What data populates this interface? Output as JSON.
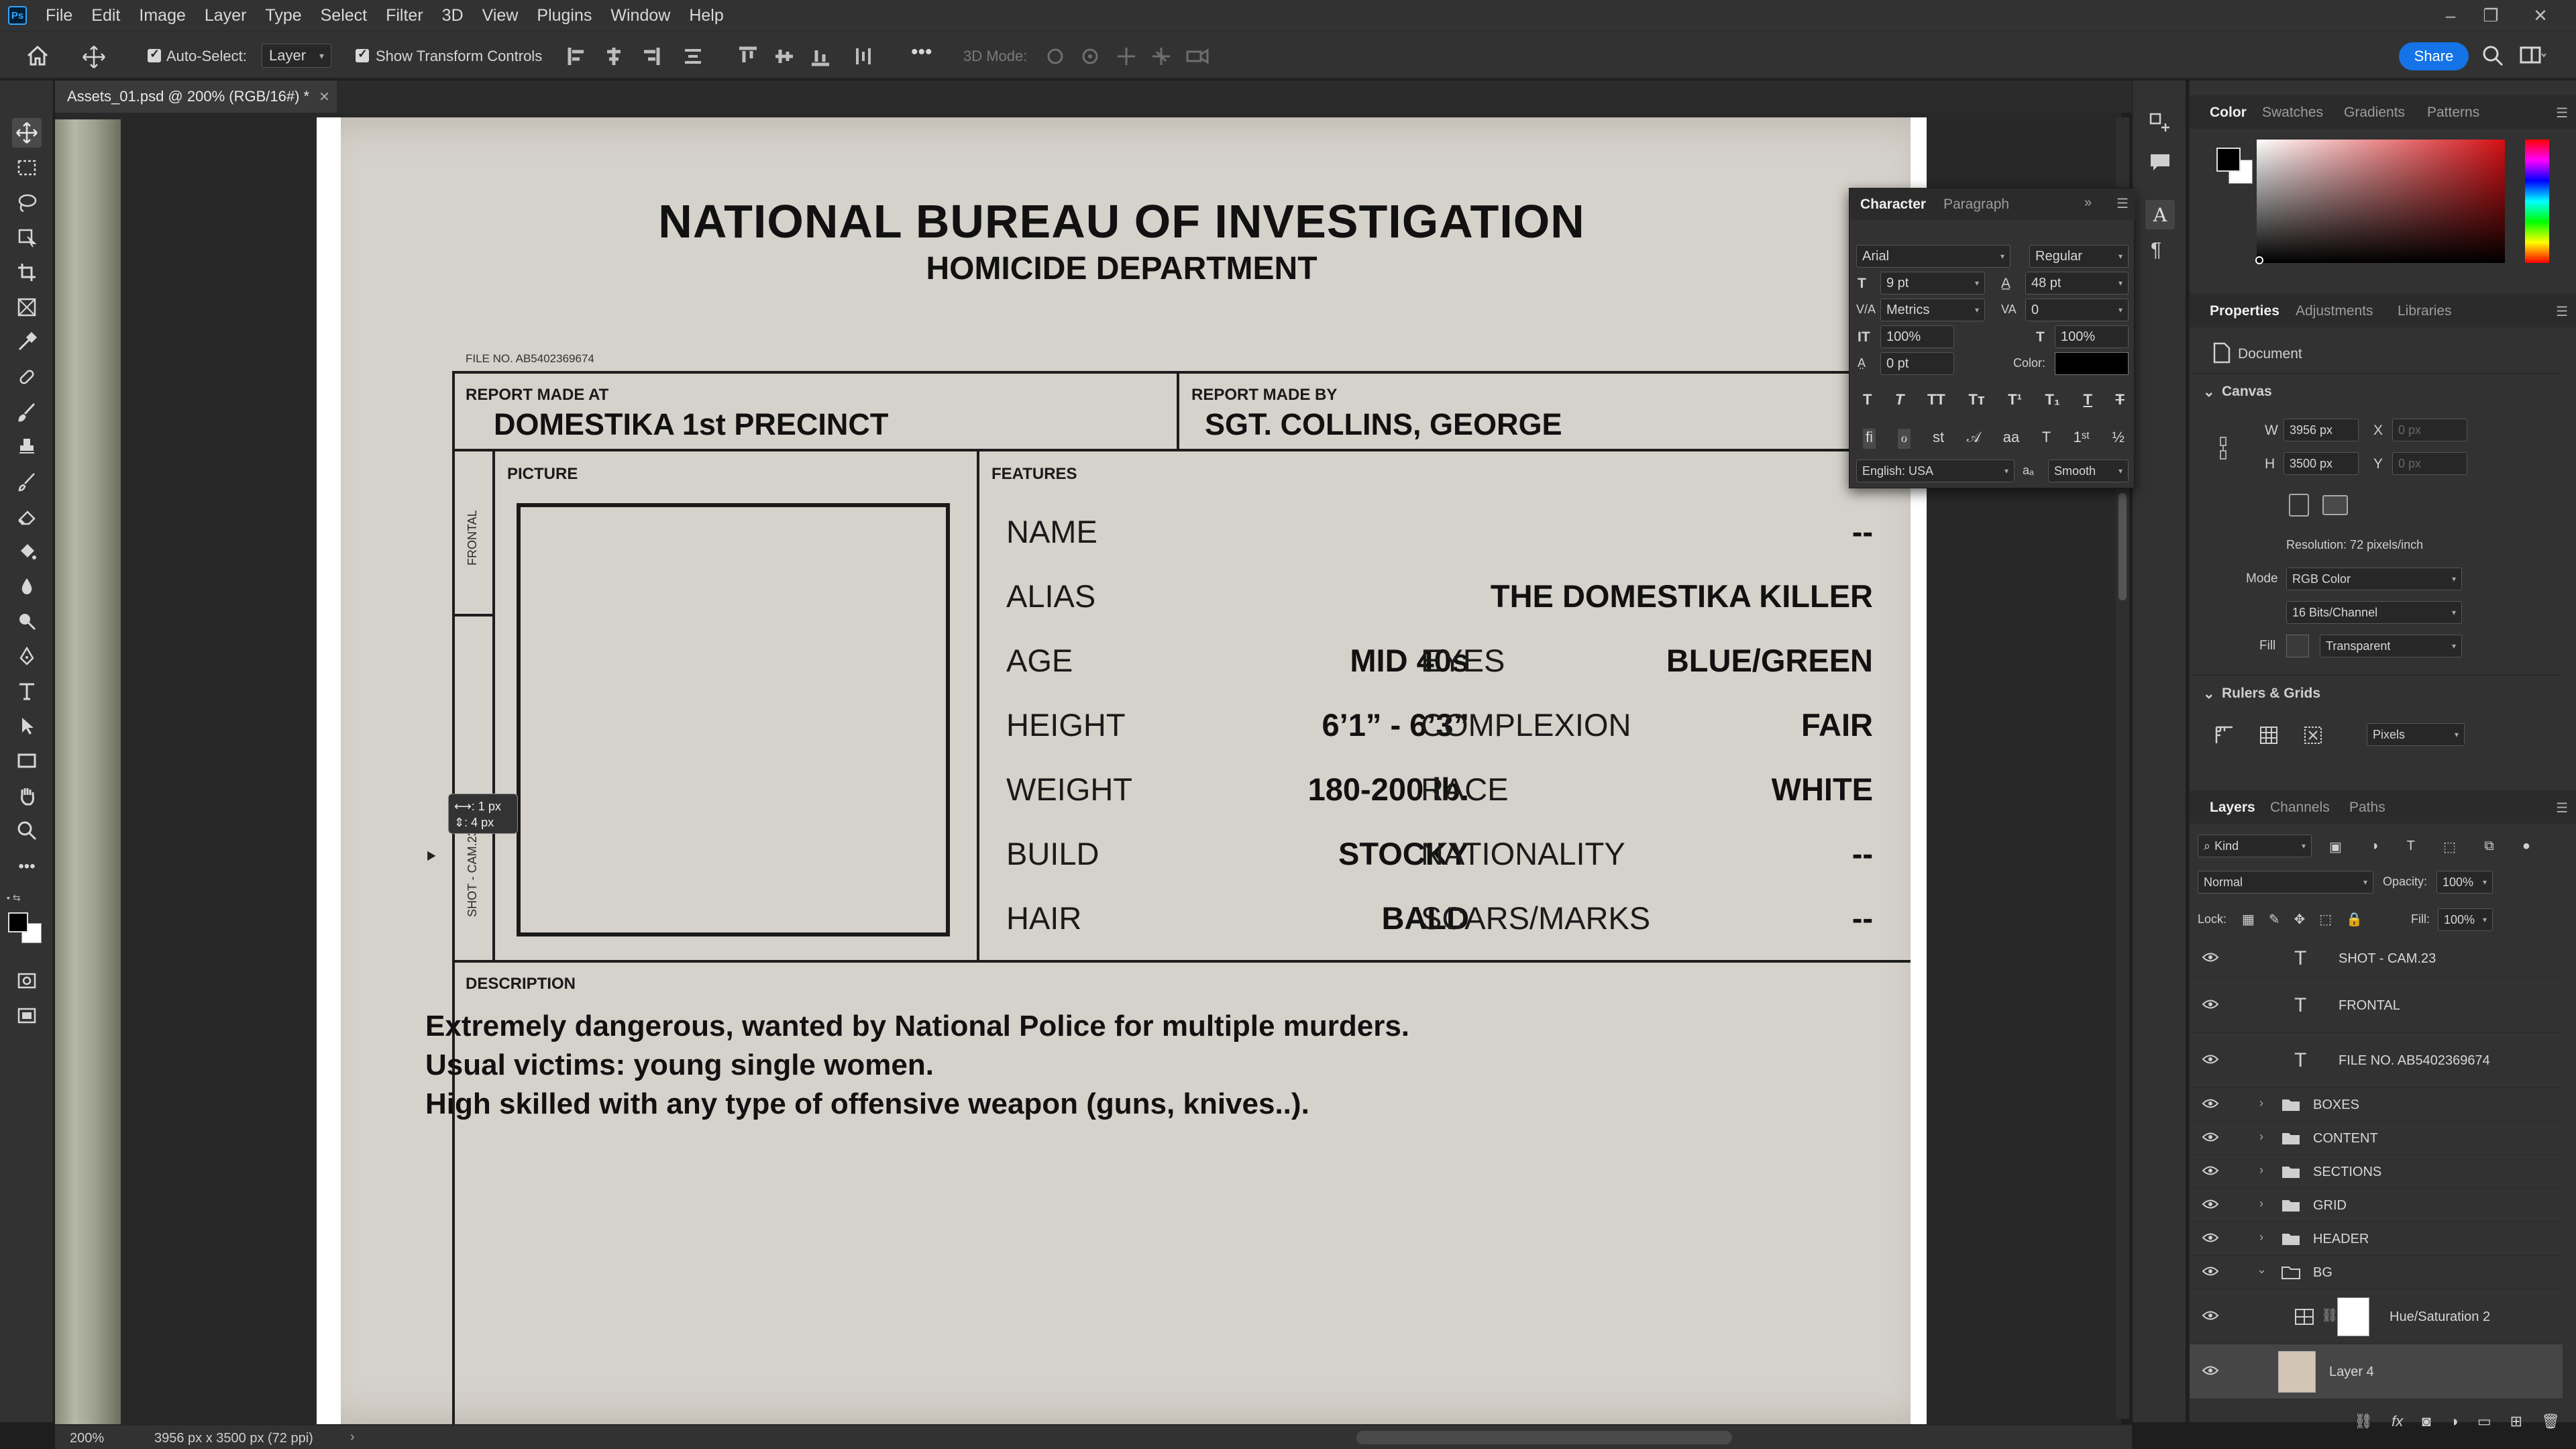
{
  "menubar": {
    "items": [
      "File",
      "Edit",
      "Image",
      "Layer",
      "Type",
      "Select",
      "Filter",
      "3D",
      "View",
      "Plugins",
      "Window",
      "Help"
    ]
  },
  "options": {
    "auto_select_label": "Auto-Select:",
    "auto_select_value": "Layer",
    "transform_controls_label": "Show Transform Controls",
    "mode_3d_label": "3D Mode:",
    "share_label": "Share"
  },
  "document": {
    "tab_title": "Assets_01.psd @ 200% (RGB/16#) *",
    "title": "NATIONAL BUREAU OF INVESTIGATION",
    "subtitle": "HOMICIDE DEPARTMENT",
    "file_no": "FILE NO. AB5402369674",
    "report_made_at_label": "REPORT MADE AT",
    "report_made_at_value": "DOMESTIKA 1st PRECINCT",
    "report_made_by_label": "REPORT MADE BY",
    "report_made_by_value": "SGT. COLLINS, GEORGE",
    "picture_label": "PICTURE",
    "frontal_label": "FRONTAL",
    "shot_label": "SHOT - CAM.23",
    "features_label": "FEATURES",
    "features": {
      "name_label": "NAME",
      "name_value": "--",
      "alias_label": "ALIAS",
      "alias_value": "THE DOMESTIKA KILLER",
      "age_label": "AGE",
      "age_value": "MID 40s",
      "eyes_label": "EYES",
      "eyes_value": "BLUE/GREEN",
      "height_label": "HEIGHT",
      "height_value": "6’1” - 6’3”",
      "complexion_label": "COMPLEXION",
      "complexion_value": "FAIR",
      "weight_label": "WEIGHT",
      "weight_value": "180-200 lb.",
      "race_label": "RACE",
      "race_value": "WHITE",
      "build_label": "BUILD",
      "build_value": "STOCKY",
      "nationality_label": "NATIONALITY",
      "nationality_value": "--",
      "hair_label": "HAIR",
      "hair_value": "BALD",
      "scars_label": "SCARS/MARKS",
      "scars_value": "--"
    },
    "description_label": "DESCRIPTION",
    "description_lines": [
      "Extremely dangerous, wanted by National Police for multiple murders.",
      "Usual victims: young single women.",
      "High skilled with any type of offensive weapon (guns, knives..)."
    ]
  },
  "tooltip": {
    "line1": "⟷: 1 px",
    "line2": "⇕: 4 px"
  },
  "status": {
    "zoom": "200%",
    "doc_size": "3956 px x 3500 px (72 ppi)"
  },
  "character_panel": {
    "tabs": [
      "Character",
      "Paragraph"
    ],
    "font_family": "Arial",
    "font_style": "Regular",
    "font_size": "9 pt",
    "leading": "48 pt",
    "kerning": "Metrics",
    "tracking": "0",
    "vertical_scale": "100%",
    "horizontal_scale": "100%",
    "baseline_shift": "0 pt",
    "color_label": "Color:",
    "language": "English: USA",
    "antialias": "Smooth",
    "text_color": "#000000"
  },
  "color_panel": {
    "tabs": [
      "Color",
      "Swatches",
      "Gradients",
      "Patterns"
    ],
    "foreground": "#000000",
    "background": "#ffffff",
    "hue_color": "#d41014"
  },
  "properties_panel": {
    "tabs": [
      "Properties",
      "Adjustments",
      "Libraries"
    ],
    "doc_label": "Document",
    "canvas_label": "Canvas",
    "w_label": "W",
    "w_value": "3956 px",
    "h_label": "H",
    "h_value": "3500 px",
    "x_label": "X",
    "x_placeholder": "0 px",
    "y_label": "Y",
    "y_placeholder": "0 px",
    "resolution": "Resolution: 72 pixels/inch",
    "mode_label": "Mode",
    "mode_value": "RGB Color",
    "bits_value": "16 Bits/Channel",
    "fill_label": "Fill",
    "fill_value": "Transparent",
    "rulers_label": "Rulers & Grids",
    "units_value": "Pixels"
  },
  "layers_panel": {
    "tabs": [
      "Layers",
      "Channels",
      "Paths"
    ],
    "filter_kind": "Kind",
    "blend_mode": "Normal",
    "opacity_label": "Opacity:",
    "opacity_value": "100%",
    "lock_label": "Lock:",
    "fill_label": "Fill:",
    "fill_value": "100%",
    "layers": [
      {
        "name": "SHOT - CAM.23",
        "type": "text"
      },
      {
        "name": "FRONTAL",
        "type": "text"
      },
      {
        "name": "FILE NO. AB5402369674",
        "type": "text"
      },
      {
        "name": "BOXES",
        "type": "group"
      },
      {
        "name": "CONTENT",
        "type": "group"
      },
      {
        "name": "SECTIONS",
        "type": "group"
      },
      {
        "name": "GRID",
        "type": "group"
      },
      {
        "name": "HEADER",
        "type": "group"
      },
      {
        "name": "BG",
        "type": "group-open"
      },
      {
        "name": "Hue/Saturation 2",
        "type": "adjustment"
      },
      {
        "name": "Layer 4",
        "type": "pixel"
      }
    ]
  }
}
